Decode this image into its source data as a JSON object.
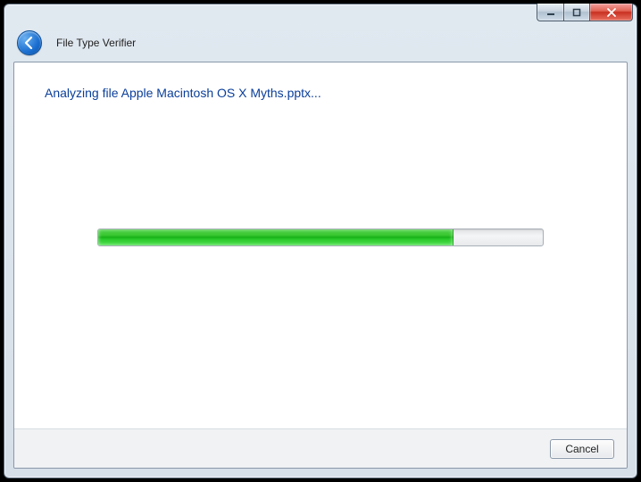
{
  "window": {
    "app_title": "File Type Verifier"
  },
  "status": {
    "message": "Analyzing file Apple Macintosh OS X Myths.pptx..."
  },
  "progress": {
    "percent": 80
  },
  "footer": {
    "cancel_label": "Cancel"
  }
}
